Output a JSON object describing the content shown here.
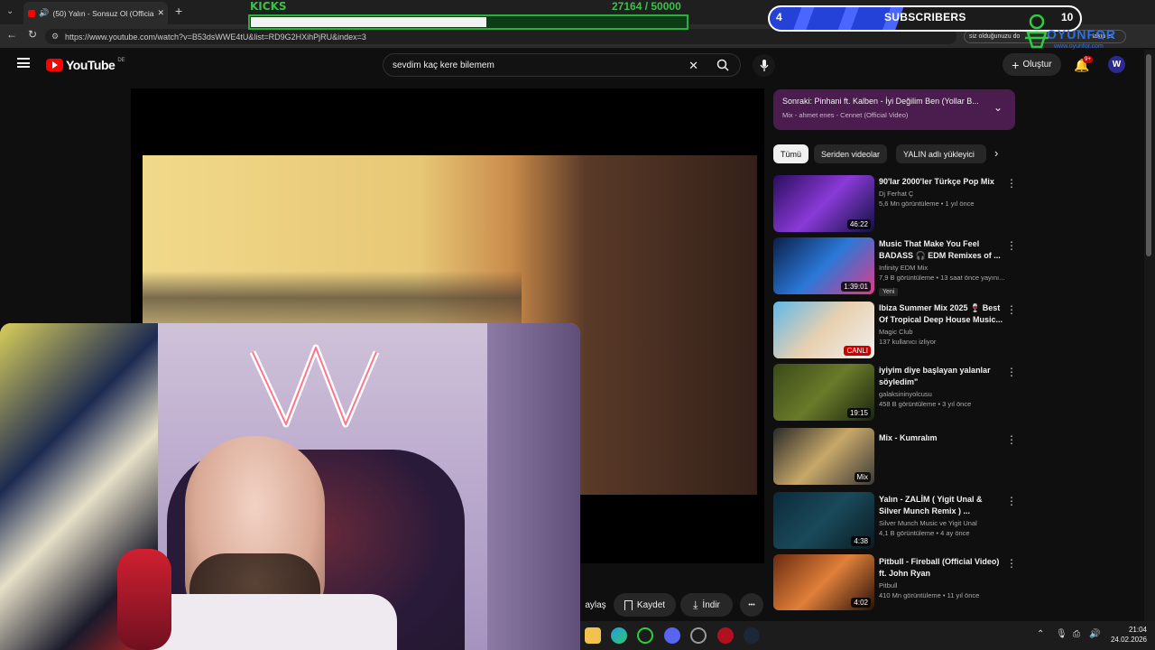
{
  "browser": {
    "tab_title": "(50) Yalın - Sonsuz Ol (Officia",
    "url": "https://www.youtube.com/watch?v=B53dsWWE4tU&list=RD9G2HXihPjRU&index=3",
    "new_tab_symbol": "+",
    "close_symbol": "✕",
    "right_snippet": "siz olduğunuzu do",
    "right_snippet2": "takip et"
  },
  "overlay": {
    "kicks_label": "KICKS",
    "kicks_count": "27164  /  50000",
    "kicks_progress": 0.543,
    "subs_left": "4",
    "subs_label": "SUBSCRIBERS",
    "subs_right": "10",
    "brand_text": "OYUNFOR",
    "brand_url": "www.oyunfor.com"
  },
  "youtube": {
    "logo_text": "YouTube",
    "region": "DE",
    "search_value": "sevdim kaç kere bilemem",
    "create_label": "Oluştur",
    "notif_badge": "9+",
    "avatar_letter": "W"
  },
  "actions": {
    "share": "aylaş",
    "save": "Kaydet",
    "download": "İndir",
    "more": "•••"
  },
  "upnext": {
    "title": "Sonraki: Pinhani ft. Kalben - İyi Değilim Ben (Yollar B...",
    "subtitle": "Mix - ahmet enes - Cennet (Official Video)"
  },
  "chips": [
    "Tümü",
    "Seriden videolar",
    "YALIN adlı yükleyici"
  ],
  "recommendations": [
    {
      "title": "90'lar 2000'ler Türkçe Pop Mix",
      "channel": "Dj Ferhat Ç",
      "meta": "5,6 Mn görüntüleme • 1 yıl önce",
      "duration": "46:22",
      "badge": ""
    },
    {
      "title": "Music That Make You Feel BADASS 🎧 EDM Remixes of ...",
      "channel": "Infinity EDM Mix",
      "meta": "7,9 B görüntüleme • 13 saat önce yayını...",
      "duration": "1:39:01",
      "badge": "Yeni"
    },
    {
      "title": "Ibiza Summer Mix 2025 🍷 Best Of Tropical Deep House Music...",
      "channel": "Magic Club",
      "meta": "137 kullanıcı izliyor",
      "duration": "CANLI",
      "badge": ""
    },
    {
      "title": "iyiyim diye başlayan yalanlar söyledim\"",
      "channel": "galaksininyolcusu",
      "meta": "458 B görüntüleme • 3 yıl önce",
      "duration": "19:15",
      "badge": ""
    },
    {
      "title": "Mix - Kumralım",
      "channel": "",
      "meta": "",
      "duration": "Mix",
      "badge": ""
    },
    {
      "title": "Yalın - ZALİM ( Yigit Unal & Silver Munch Remix ) ...",
      "channel": "Silver Munch Music ve Yigit Unal",
      "meta": "4,1 B görüntüleme • 4 ay önce",
      "duration": "4:38",
      "badge": ""
    },
    {
      "title": "Pitbull - Fireball (Official Video) ft. John Ryan",
      "channel": "Pitbull",
      "meta": "410 Mn görüntüleme • 11 yıl önce",
      "duration": "4:02",
      "badge": ""
    }
  ],
  "taskbar": {
    "time": "21:04",
    "date": "24.02.2026"
  },
  "colors": {
    "accent_green": "#39c24a",
    "youtube_red": "#ff0000",
    "upnext_bg": "#4b1d4e"
  }
}
